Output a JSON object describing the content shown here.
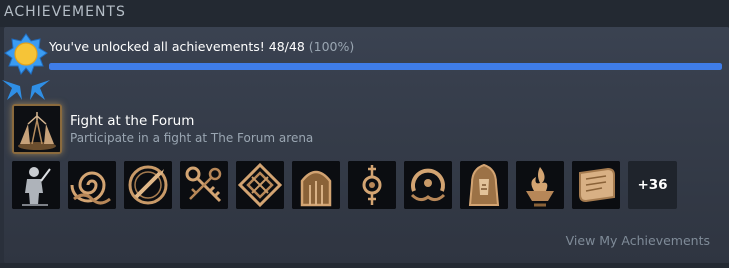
{
  "header": {
    "title": "ACHIEVEMENTS"
  },
  "summary": {
    "text": "You've unlocked all achievements! 48/48",
    "percent_text": "(100%)",
    "unlocked": 48,
    "total": 48,
    "progress": 1.0
  },
  "featured": {
    "icon": "forum-arena-icon",
    "title": "Fight at the Forum",
    "description": "Participate in a fight at The Forum arena"
  },
  "achievement_icons": [
    "warrior-statue-icon",
    "spiral-waves-icon",
    "shield-spear-icon",
    "keys-icon",
    "knot-diamond-icon",
    "arched-door-icon",
    "ornate-key-icon",
    "serpent-ring-icon",
    "hooded-elder-icon",
    "fire-bowl-icon",
    "scroll-icon"
  ],
  "more": {
    "label": "+36"
  },
  "link": {
    "label": "View My Achievements"
  },
  "colors": {
    "accent": "#3f7de8",
    "icon_gold": "#d3a472",
    "medal_blue": "#3b9cf2",
    "medal_sun": "#f6c437"
  }
}
